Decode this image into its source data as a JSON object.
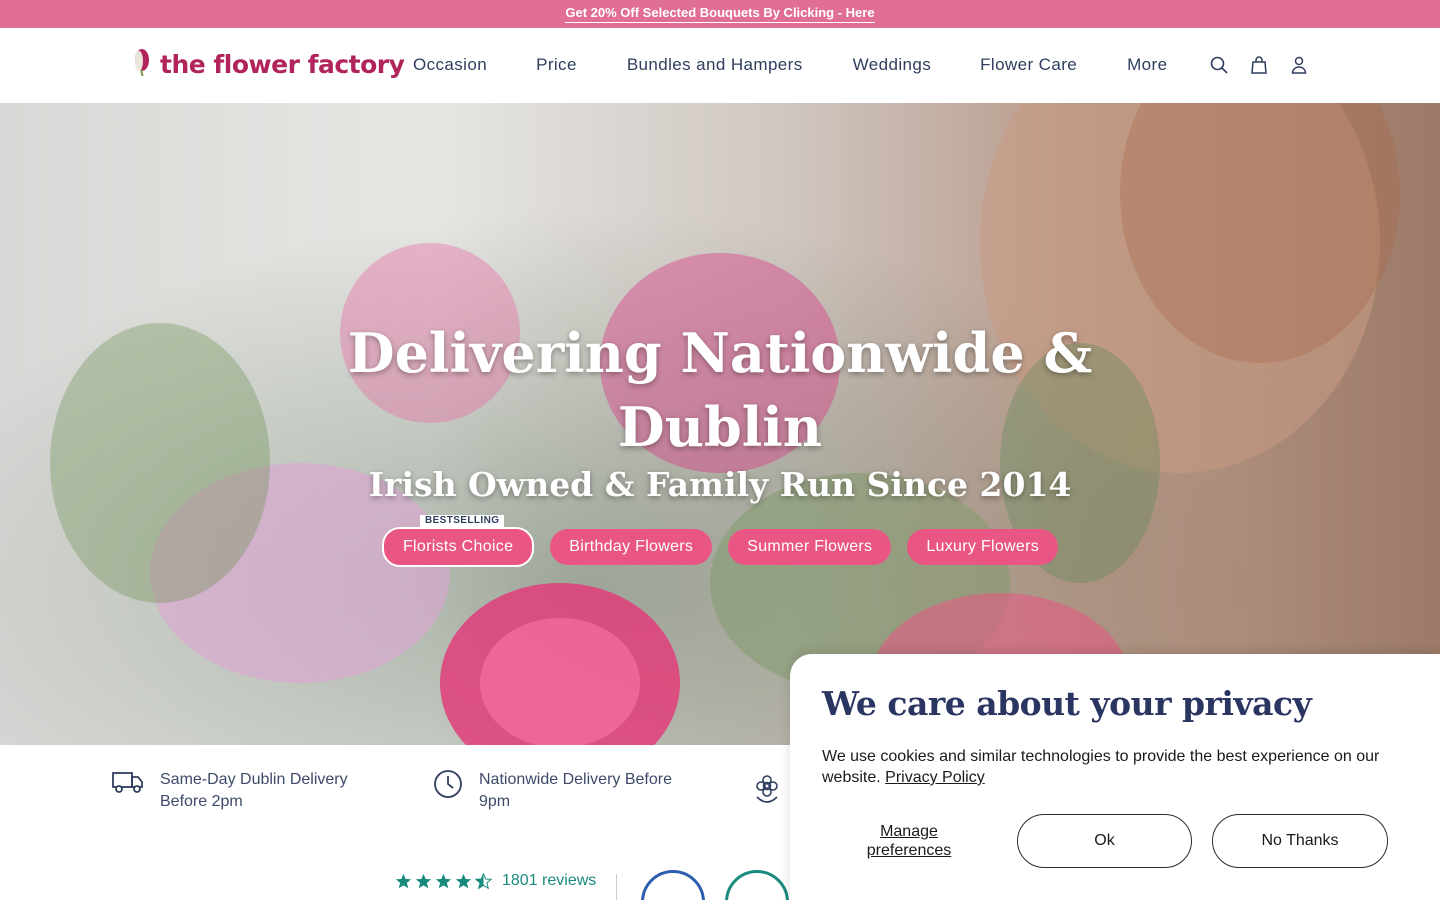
{
  "promo": {
    "text": "Get 20% Off Selected Bouquets By Clicking - Here"
  },
  "header": {
    "logo_text": "the flower factory",
    "nav": [
      "Occasion",
      "Price",
      "Bundles and Hampers",
      "Weddings",
      "Flower Care",
      "More"
    ],
    "icons": [
      "search-icon",
      "bag-icon",
      "account-icon"
    ]
  },
  "hero": {
    "title_line1": "Delivering Nationwide &",
    "title_line2": "Dublin",
    "subtitle": "Irish Owned & Family Run Since 2014",
    "badge": "BESTSELLING",
    "pills": [
      "Florists Choice",
      "Birthday Flowers",
      "Summer Flowers",
      "Luxury Flowers"
    ],
    "pill_color": "#e95683"
  },
  "features": [
    {
      "icon": "truck-icon",
      "line1": "Same-Day Dublin Delivery",
      "line2": "Before 2pm"
    },
    {
      "icon": "clock-icon",
      "line1": "Nationwide Delivery Before",
      "line2": "9pm"
    },
    {
      "icon": "flower-icon",
      "line1": "",
      "line2": ""
    }
  ],
  "reviews": {
    "rating": 4.5,
    "count_text": "1801 reviews"
  },
  "cookie": {
    "title": "We care about your privacy",
    "body": "We use cookies and similar technologies to provide the best experience on our website.",
    "policy_link": "Privacy Policy",
    "manage": "Manage preferences",
    "ok": "Ok",
    "no_thanks": "No Thanks"
  },
  "colors": {
    "brand": "#b1235b",
    "promo_bg": "#e06f93",
    "accent": "#e95683",
    "reviews": "#1a8a7e",
    "navy": "#2b3561"
  }
}
